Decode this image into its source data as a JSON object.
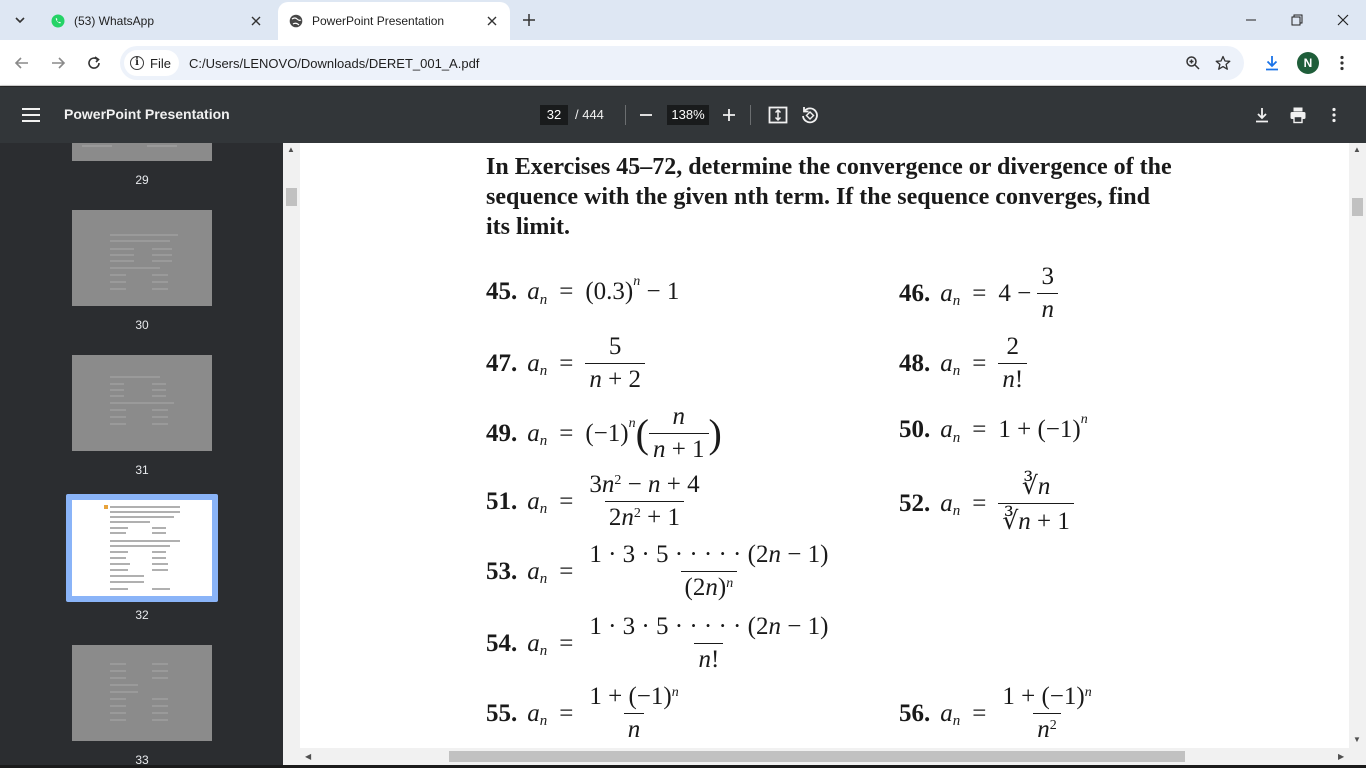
{
  "browser": {
    "tabs": [
      {
        "title": "(53) WhatsApp",
        "icon": "whatsapp-icon",
        "active": false
      },
      {
        "title": "PowerPoint Presentation",
        "icon": "globe-icon",
        "active": true
      }
    ],
    "url_scheme_label": "File",
    "url": "C:/Users/LENOVO/Downloads/DERET_001_A.pdf",
    "profile_initial": "N"
  },
  "viewer": {
    "title": "PowerPoint Presentation",
    "current_page": "32",
    "total_pages": "/ 444",
    "zoom": "138%"
  },
  "sidebar": {
    "thumbnails": [
      {
        "label": "29",
        "selected": false
      },
      {
        "label": "30",
        "selected": false
      },
      {
        "label": "31",
        "selected": false
      },
      {
        "label": "32",
        "selected": true
      },
      {
        "label": "33",
        "selected": false
      }
    ]
  },
  "page": {
    "instructions": "In Exercises 45–72, determine the convergence or divergence of the sequence with the given nth term. If the sequence converges, find its limit.",
    "exercises": [
      {
        "num": "45.",
        "expr": "(0.3)ⁿ − 1"
      },
      {
        "num": "46.",
        "expr": "4 − 3/n"
      },
      {
        "num": "47.",
        "expr": "5/(n + 2)"
      },
      {
        "num": "48.",
        "expr": "2/n!"
      },
      {
        "num": "49.",
        "expr": "(−1)ⁿ(n/(n + 1))"
      },
      {
        "num": "50.",
        "expr": "1 + (−1)ⁿ"
      },
      {
        "num": "51.",
        "expr": "(3n² − n + 4)/(2n² + 1)"
      },
      {
        "num": "52.",
        "expr": "∛n/(∛n + 1)"
      },
      {
        "num": "53.",
        "expr": "1 · 3 · 5 · . . . · (2n − 1)/(2n)ⁿ"
      },
      {
        "num": "54.",
        "expr": "1 · 3 · 5 · . . . · (2n − 1)/n!"
      },
      {
        "num": "55.",
        "expr": "(1 + (−1)ⁿ)/n"
      },
      {
        "num": "56.",
        "expr": "(1 + (−1)ⁿ)/n²"
      }
    ]
  }
}
